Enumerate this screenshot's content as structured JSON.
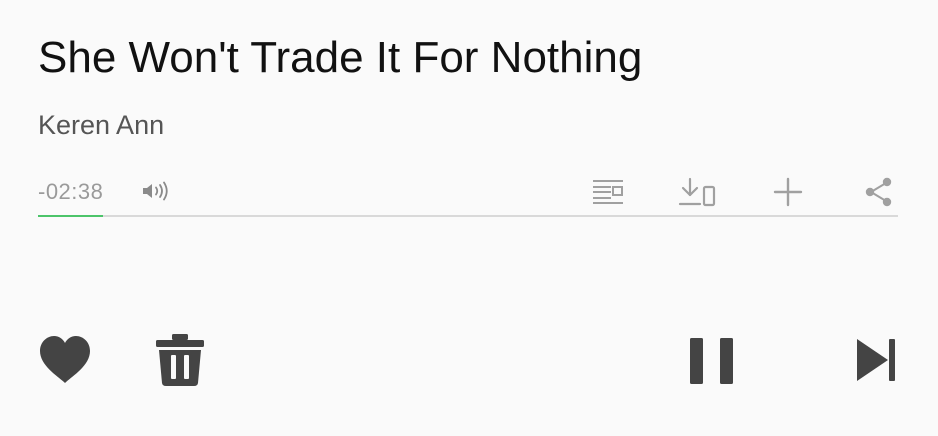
{
  "track": {
    "title": "She Won't Trade It For Nothing",
    "artist": "Keren Ann"
  },
  "playback": {
    "remaining_time": "-02:38",
    "progress": 0.075,
    "state": "playing"
  },
  "colors": {
    "background": "#fafafa",
    "title": "#111111",
    "artist": "#555555",
    "muted_icon": "#a0a0a0",
    "progress_track": "#d9d9d9",
    "progress_fill": "#4cc46a",
    "control": "#444444"
  },
  "toolbar": {
    "icons": [
      "volume-icon",
      "lyrics-icon",
      "download-to-device-icon",
      "add-icon",
      "share-icon"
    ]
  },
  "controls": {
    "icons": [
      "heart-icon",
      "trash-icon",
      "pause-icon",
      "skip-next-icon"
    ]
  }
}
